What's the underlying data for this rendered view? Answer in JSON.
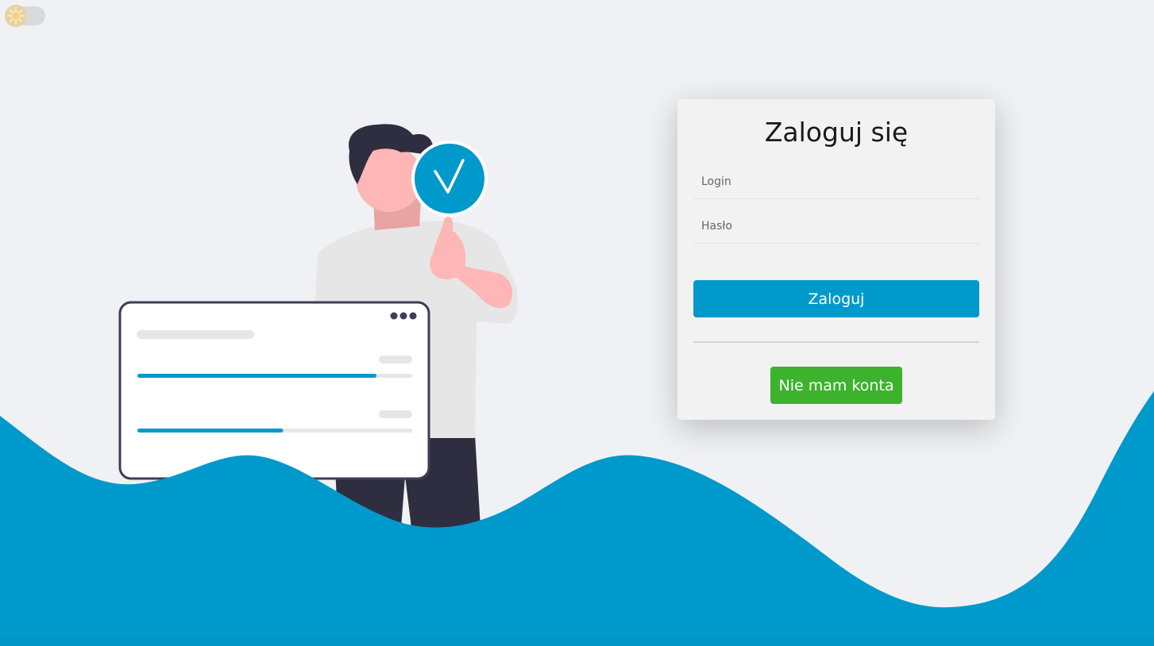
{
  "theme_toggle": {
    "icon": "sun-icon",
    "state": "light"
  },
  "login_form": {
    "title": "Zaloguj się",
    "login_placeholder": "Login",
    "password_placeholder": "Hasło",
    "submit_label": "Zaloguj",
    "register_label": "Nie mam konta"
  },
  "colors": {
    "accent": "#0099cc",
    "success": "#3db22d",
    "background": "#f0f1f4",
    "card": "#f2f2f2"
  },
  "illustration": {
    "check_icon": "checkmark-icon",
    "progress_bars": [
      0.87,
      0.53
    ]
  }
}
